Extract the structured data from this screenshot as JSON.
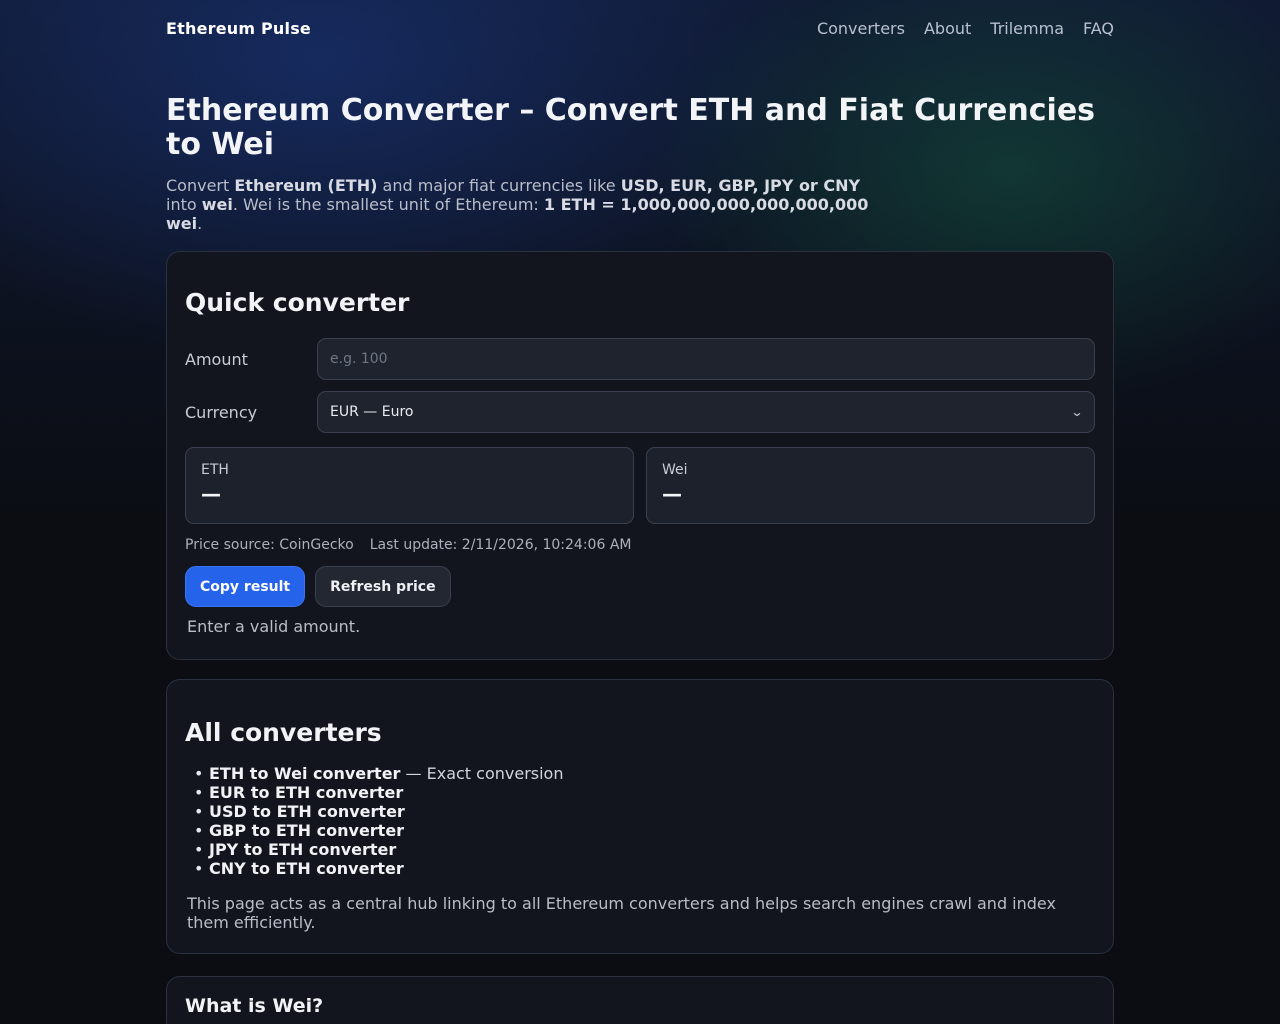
{
  "header": {
    "brand": "Ethereum Pulse",
    "nav": [
      "Converters",
      "About",
      "Trilemma",
      "FAQ"
    ]
  },
  "hero": {
    "title": "Ethereum Converter – Convert ETH and Fiat Currencies to Wei",
    "lead": {
      "p1": "Convert ",
      "b1": "Ethereum (ETH)",
      "p2": " and major fiat currencies like ",
      "b2": "USD, EUR, GBP, JPY or CNY",
      "p3": " into ",
      "b3": "wei",
      "p4": ". Wei is the smallest unit of Ethereum: ",
      "b4": "1 ETH = 1,000,000,000,000,000,000 wei",
      "p5": "."
    }
  },
  "quick": {
    "title": "Quick converter",
    "amount_label": "Amount",
    "amount_value": "",
    "amount_placeholder": "e.g. 100",
    "currency_label": "Currency",
    "currency_selected": "EUR — Euro",
    "eth_label": "ETH",
    "eth_value": "—",
    "wei_label": "Wei",
    "wei_value": "—",
    "price_source": "Price source: CoinGecko",
    "last_update": "Last update: 2/11/2026, 10:24:06 AM",
    "copy_button": "Copy result",
    "refresh_button": "Refresh price",
    "hint": "Enter a valid amount."
  },
  "all": {
    "title": "All converters",
    "items": [
      {
        "link": "ETH to Wei converter",
        "suffix": " — Exact conversion"
      },
      {
        "link": "EUR to ETH converter",
        "suffix": ""
      },
      {
        "link": "USD to ETH converter",
        "suffix": ""
      },
      {
        "link": "GBP to ETH converter",
        "suffix": ""
      },
      {
        "link": "JPY to ETH converter",
        "suffix": ""
      },
      {
        "link": "CNY to ETH converter",
        "suffix": ""
      }
    ],
    "note": "This page acts as a central hub linking to all Ethereum converters and helps search engines crawl and index them efficiently."
  },
  "wei_section": {
    "title": "What is Wei?"
  }
}
